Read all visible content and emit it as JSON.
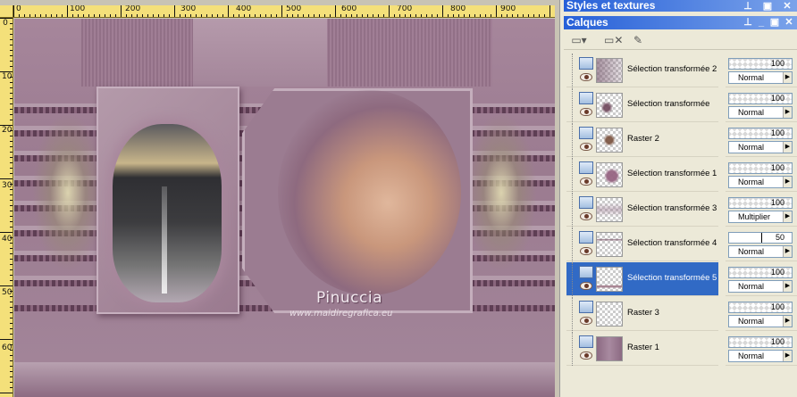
{
  "canvas": {
    "ruler_top_labels": [
      "0",
      "100",
      "200",
      "300",
      "400",
      "500",
      "600",
      "700",
      "800",
      "900"
    ],
    "ruler_left_labels": [
      "0",
      "100",
      "200",
      "300",
      "400",
      "500",
      "600"
    ],
    "signature": "Pinuccia",
    "website": "www.maidiregrafica.eu"
  },
  "palettes": {
    "styles_title": "Styles et textures",
    "layers_title": "Calques"
  },
  "layers": [
    {
      "name": "Sélection transformée 2",
      "opacity": "100",
      "blend": "Normal",
      "selected": false
    },
    {
      "name": "Sélection transformée",
      "opacity": "100",
      "blend": "Normal",
      "selected": false
    },
    {
      "name": "Raster 2",
      "opacity": "100",
      "blend": "Normal",
      "selected": false
    },
    {
      "name": "Sélection transformée 1",
      "opacity": "100",
      "blend": "Normal",
      "selected": false
    },
    {
      "name": "Sélection transformée 3",
      "opacity": "100",
      "blend": "Multiplier",
      "selected": false
    },
    {
      "name": "Sélection transformée 4",
      "opacity": "50",
      "blend": "Normal",
      "selected": false
    },
    {
      "name": "Sélection transformée 5",
      "opacity": "100",
      "blend": "Normal",
      "selected": true
    },
    {
      "name": "Raster 3",
      "opacity": "100",
      "blend": "Normal",
      "selected": false
    },
    {
      "name": "Raster 1",
      "opacity": "100",
      "blend": "Normal",
      "selected": false
    }
  ],
  "colors": {
    "selection": "#316ac5",
    "title_bar": "#2660d8",
    "canvas_bg": "#9b7b90"
  }
}
